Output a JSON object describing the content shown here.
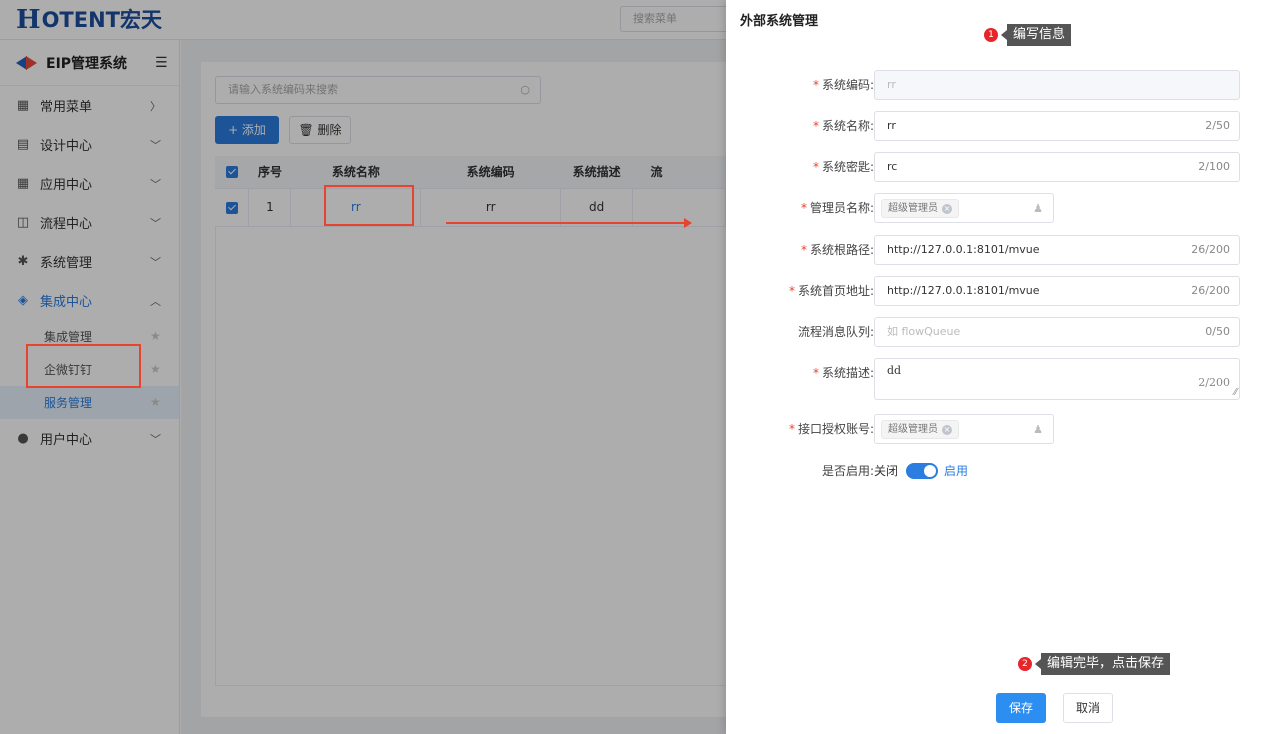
{
  "app": {
    "logo_mark": "H",
    "logo_text": "OTENT宏天",
    "menu_search_placeholder": "搜索菜单"
  },
  "sidebar": {
    "title": "EIP管理系统",
    "items": [
      {
        "label": "常用菜单",
        "arrow": "〉"
      },
      {
        "label": "设计中心",
        "arrow": "﹀"
      },
      {
        "label": "应用中心",
        "arrow": "﹀"
      },
      {
        "label": "流程中心",
        "arrow": "﹀"
      },
      {
        "label": "系统管理",
        "arrow": "﹀"
      },
      {
        "label": "集成中心",
        "arrow": "︿"
      },
      {
        "label": "用户中心",
        "arrow": "﹀"
      }
    ],
    "sub_items": [
      {
        "label": "集成管理"
      },
      {
        "label": "企微钉钉"
      },
      {
        "label": "服务管理"
      }
    ]
  },
  "list": {
    "search_placeholder": "请输入系统编码来搜索",
    "add_label": "+ 添加",
    "delete_label": "删除",
    "columns": [
      "序号",
      "系统名称",
      "系统编码",
      "系统描述",
      "流"
    ],
    "rows": [
      {
        "index": "1",
        "name": "rr",
        "code": "rr",
        "desc": "dd"
      }
    ]
  },
  "drawer": {
    "title": "外部系统管理",
    "fields": {
      "code": {
        "label": "系统编码:",
        "value": "rr"
      },
      "name": {
        "label": "系统名称:",
        "value": "rr",
        "count": "2/50"
      },
      "secret": {
        "label": "系统密匙:",
        "value": "rc",
        "count": "2/100"
      },
      "admin": {
        "label": "管理员名称:",
        "tag": "超级管理员"
      },
      "root_path": {
        "label": "系统根路径:",
        "value": "http://127.0.0.1:8101/mvue",
        "count": "26/200"
      },
      "home_url": {
        "label": "系统首页地址:",
        "value": "http://127.0.0.1:8101/mvue",
        "count": "26/200"
      },
      "queue": {
        "label": "流程消息队列:",
        "placeholder": "如 flowQueue",
        "count": "0/50"
      },
      "desc": {
        "label": "系统描述:",
        "value": "dd",
        "count": "2/200"
      },
      "api_account": {
        "label": "接口授权账号:",
        "tag": "超级管理员"
      },
      "enabled": {
        "label": "是否启用:",
        "off_label": "关闭",
        "on_label": "启用",
        "value": true
      }
    },
    "save_label": "保存",
    "cancel_label": "取消"
  },
  "callouts": {
    "step1": {
      "num": "1",
      "text": "编写信息"
    },
    "step2": {
      "num": "2",
      "text": "编辑完毕，点击保存"
    }
  },
  "colors": {
    "primary": "#2b7de0",
    "annotation_red": "#e8432e",
    "logo_blue": "#1d4e9e"
  }
}
